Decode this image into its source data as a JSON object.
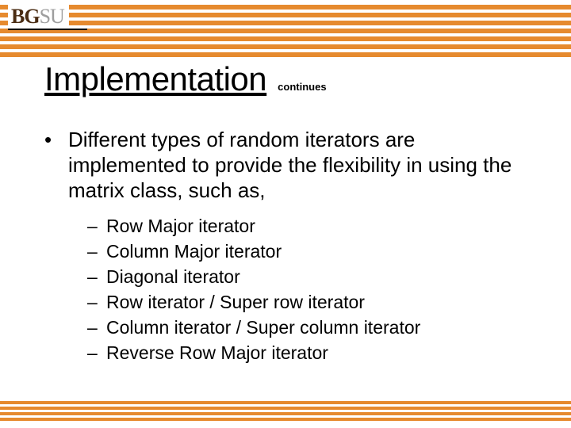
{
  "logo": {
    "bold": "BG",
    "light": "SU"
  },
  "title": "Implementation",
  "subtitle": "continues",
  "list": {
    "item1": "Different types of random iterators are implemented to provide the flexibility in using the matrix class, such as,",
    "subitems": {
      "a": "Row Major iterator",
      "b": "Column Major iterator",
      "c": "Diagonal iterator",
      "d": "Row iterator / Super row iterator",
      "e": "Column iterator / Super column iterator",
      "f": "Reverse Row Major iterator"
    }
  }
}
